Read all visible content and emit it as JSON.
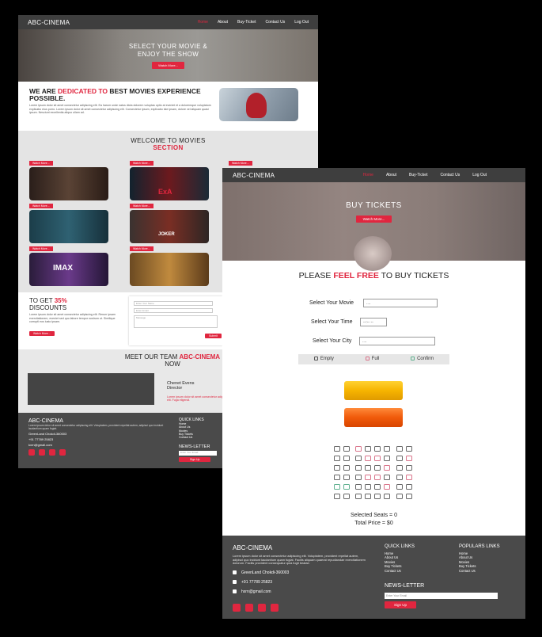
{
  "brand": "ABC-CINEMA",
  "back": {
    "nav": [
      "Home",
      "About",
      "Buy-Ticket",
      "Contact Us",
      "Log Out"
    ],
    "hero_title": "SELECT YOUR MOVIE & ENJOY THE SHOW",
    "hero_button": "Watch More...",
    "dedicated_pre": "WE ARE ",
    "dedicated_red": "DEDICATED TO",
    "dedicated_post": " BEST MOVIES EXPERIENCE POSSIBLE.",
    "dedicated_body": "Lorem ipsum dolor sit amet consectetur adipiscing elit. Ea harum unde natus dicta dolorem voluptas optio at eveniet et a doloremque voluptatum explicabo eius porro. Lorem ipsum dolor sit amet consectetur adipiscing elit. Consectetur ipsum, explicabo iste ipsam, dolore vel aliquam quasi ipsum. Nesciunt excellentia aliquo ullam ad.",
    "welcome_pre": "WELCOME TO MOVIES",
    "welcome_red": "SECTION",
    "watch_more": "Watch More...",
    "poster_labels": [
      "",
      "ExA",
      "",
      "",
      "JOKER",
      "",
      "IMAX",
      ""
    ],
    "discount_pre": "TO GET ",
    "discount_red": "35%",
    "discount_post": "DISCOUNTS",
    "discount_body": "Lorem ipsum dolor sit amet consectetur adipiscing elit. Rerum ipsam exercitationem, eveniet sed quo labore tempor nostrum ut. Similique corrupti eos iusto ipsam.",
    "discount_button": "Watch More...",
    "form_placeholders": [
      "Enter Your Name",
      "Enter Email",
      "Message"
    ],
    "form_button": "Submit",
    "team_pre": "MEET OUR TEAM ",
    "team_red": "ABC-CINEMA",
    "team_post": " NOW",
    "team_name": "Chenet Evens",
    "team_role": "Director",
    "team_body": "Lorem ipsum dolor sit amet consectetur adipiscing elit. Fuga eligendi.",
    "foot_body": "Lorem ipsum dolor sit amet consectetur adipiscing elit. Voluptatem, provident repellat autem, adipisci quo incidunt laudantium quam fugiat.",
    "foot_address": "GreenLand Chokdi-360003",
    "foot_phone": "+91 77789 25823",
    "foot_email": "kxrn@gmail.com",
    "quick_title": "QUICK LINKS",
    "quick_links": [
      "Home",
      "About Us",
      "Movies",
      "Buy Tickets",
      "Contact Us"
    ],
    "news_title": "NEWS-LETTER",
    "news_placeholder": "Enter Your Email",
    "news_button": "Sign Up"
  },
  "front": {
    "nav": [
      "Home",
      "About",
      "Buy-Ticket",
      "Contact Us",
      "Log Out"
    ],
    "hero_title": "BUY TICKETS",
    "hero_button": "Watch More...",
    "title_pre": "PLEASE ",
    "title_red": "FEEL FREE",
    "title_post": " TO BUY TICKETS",
    "select_movie": "Select Your Movie",
    "movie_value": "....",
    "select_time": "Select Your Time",
    "time_value": "--:-- --",
    "select_city": "Select Your City",
    "city_value": "....",
    "legend": [
      "Empty",
      "Full",
      "Confirm"
    ],
    "selected_seats": "Selected Seats = 0",
    "total_price": "Total Price = $0",
    "foot_body": "Lorem ipsum dolor sit amet consectetur adipiscing elit. Voluptatem, provident repellat autem, adipisci quo incidunt laudantium quam fugiat. Facilis aliquam quaerat repudiandae exercitationem dolorum. Facilis provident consequatur quia fugit beatae.",
    "foot_address": "GreenLand Chokdi-360003",
    "foot_phone": "+91 77789 25823",
    "foot_email": "hxrn@gmail.com",
    "quick_title": "QUICK LINKS",
    "quick_links": [
      "Home",
      "About Us",
      "Movies",
      "Buy Tickets",
      "Contact Us"
    ],
    "popular_title": "POPULARS LINKS",
    "popular_links": [
      "Home",
      "About Us",
      "Movies",
      "Buy Tickets",
      "Contact Us"
    ],
    "news_title": "NEWS-LETTER",
    "news_placeholder": "Enter Your Email",
    "news_button": "Sign Up"
  },
  "colors": {
    "accent": "#e0263f",
    "nav": "#3e3e3e",
    "footer": "#4a4a4a",
    "ticket_yellow": "#f6b400",
    "ticket_orange": "#f05a0a",
    "seat_full": "#d9738a",
    "seat_confirm": "#5fb08f"
  }
}
